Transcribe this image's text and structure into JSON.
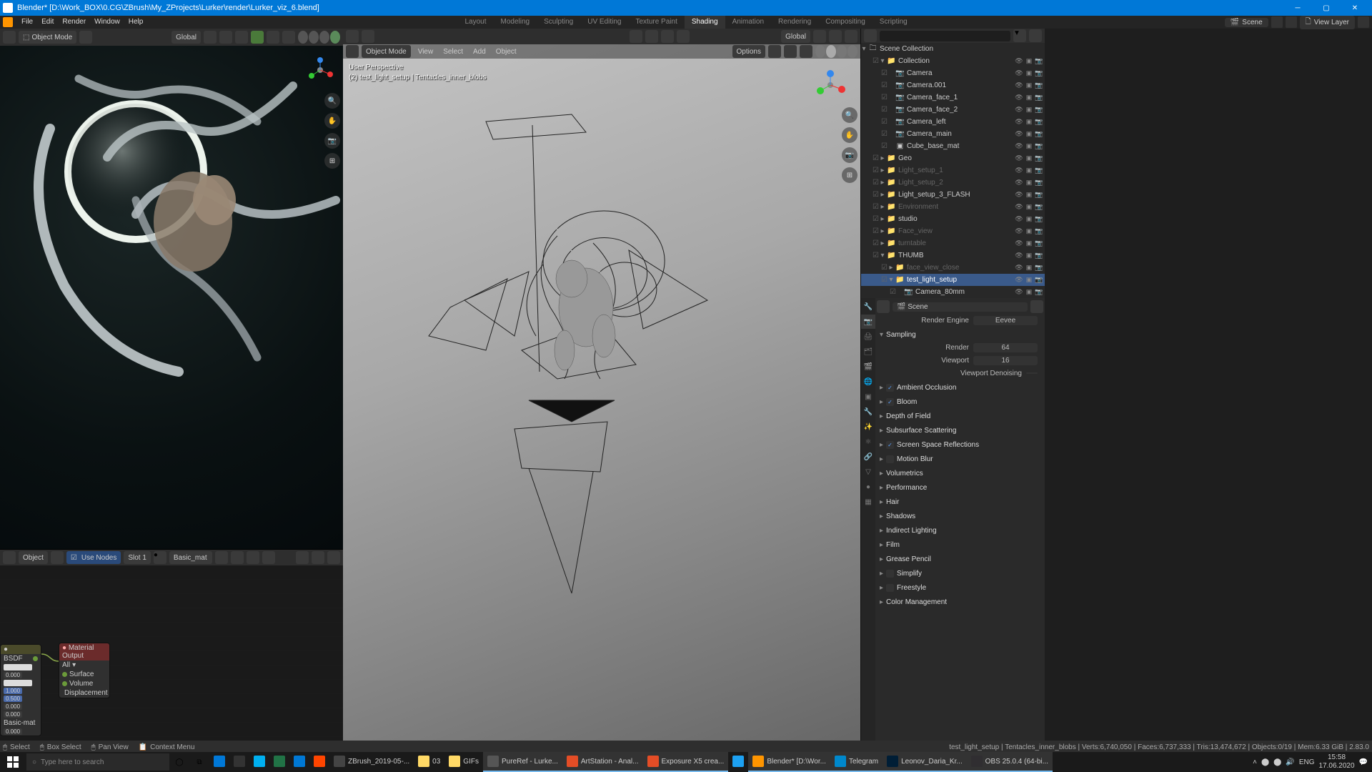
{
  "window": {
    "title": "Blender* [D:\\Work_BOX\\0.CG\\ZBrush\\My_ZProjects\\Lurker\\render\\Lurker_viz_6.blend]"
  },
  "menu": {
    "items": [
      "File",
      "Edit",
      "Render",
      "Window",
      "Help"
    ],
    "tabs": [
      "Layout",
      "Modeling",
      "Sculpting",
      "UV Editing",
      "Texture Paint",
      "Shading",
      "Animation",
      "Rendering",
      "Compositing",
      "Scripting"
    ],
    "active_tab": 5,
    "scene": "Scene",
    "view_layer": "View Layer"
  },
  "view_left": {
    "mode": "Object Mode",
    "orient": "Global"
  },
  "view_center": {
    "mode": "Object Mode",
    "menus": [
      "View",
      "Select",
      "Add",
      "Object"
    ],
    "orient": "Global",
    "options": "Options",
    "info1": "User Perspective",
    "info2": "(2) test_light_setup | Tentacles_inner_blobs"
  },
  "node": {
    "type_menu": "Object",
    "use_nodes": "Use Nodes",
    "slot": "Slot 1",
    "mat": "Basic_mat",
    "n_bsdf": "BSDF",
    "n_shader": "Basic-mat",
    "vals": [
      "0.000",
      "1.000",
      "0.500",
      "0.000",
      "0.000",
      "0.000"
    ],
    "n_out": "Material Output",
    "out_target": "All",
    "out_sockets": [
      "Surface",
      "Volume",
      "Displacement"
    ]
  },
  "outliner": {
    "root": "Scene Collection",
    "items": [
      {
        "name": "Collection",
        "i": 1,
        "tri": "▾",
        "icon": "📁",
        "dim": false
      },
      {
        "name": "Camera",
        "i": 2,
        "icon": "📷",
        "dim": false
      },
      {
        "name": "Camera.001",
        "i": 2,
        "icon": "📷",
        "dim": false
      },
      {
        "name": "Camera_face_1",
        "i": 2,
        "icon": "📷",
        "dim": false
      },
      {
        "name": "Camera_face_2",
        "i": 2,
        "icon": "📷",
        "dim": false
      },
      {
        "name": "Camera_left",
        "i": 2,
        "icon": "📷",
        "dim": false
      },
      {
        "name": "Camera_main",
        "i": 2,
        "icon": "📷",
        "dim": false
      },
      {
        "name": "Cube_base_mat",
        "i": 2,
        "icon": "▣",
        "dim": false
      },
      {
        "name": "Geo",
        "i": 1,
        "tri": "▸",
        "icon": "📁",
        "dim": false
      },
      {
        "name": "Light_setup_1",
        "i": 1,
        "tri": "▸",
        "icon": "📁",
        "dim": true
      },
      {
        "name": "Light_setup_2",
        "i": 1,
        "tri": "▸",
        "icon": "📁",
        "dim": true
      },
      {
        "name": "Light_setup_3_FLASH",
        "i": 1,
        "tri": "▸",
        "icon": "📁",
        "dim": false
      },
      {
        "name": "Environment",
        "i": 1,
        "tri": "▸",
        "icon": "📁",
        "dim": true
      },
      {
        "name": "studio",
        "i": 1,
        "tri": "▸",
        "icon": "📁",
        "dim": false
      },
      {
        "name": "Face_view",
        "i": 1,
        "tri": "▸",
        "icon": "📁",
        "dim": true
      },
      {
        "name": "turntable",
        "i": 1,
        "tri": "▸",
        "icon": "📁",
        "dim": true
      },
      {
        "name": "THUMB",
        "i": 1,
        "tri": "▾",
        "icon": "📁",
        "dim": false
      },
      {
        "name": "face_view_close",
        "i": 2,
        "tri": "▸",
        "icon": "📁",
        "dim": true
      },
      {
        "name": "test_light_setup",
        "i": 2,
        "tri": "▾",
        "icon": "📁",
        "dim": false,
        "sel": true
      },
      {
        "name": "Camera_80mm",
        "i": 3,
        "icon": "📷",
        "dim": false
      }
    ]
  },
  "props": {
    "scene_label": "Scene",
    "render_engine_lbl": "Render Engine",
    "render_engine": "Eevee",
    "sampling": "Sampling",
    "render_lbl": "Render",
    "render_val": "64",
    "viewport_lbl": "Viewport",
    "viewport_val": "16",
    "viewport_denoise": "Viewport Denoising",
    "panels": [
      {
        "name": "Ambient Occlusion",
        "chk": true
      },
      {
        "name": "Bloom",
        "chk": true
      },
      {
        "name": "Depth of Field",
        "chk": null
      },
      {
        "name": "Subsurface Scattering",
        "chk": null
      },
      {
        "name": "Screen Space Reflections",
        "chk": true
      },
      {
        "name": "Motion Blur",
        "chk": false
      },
      {
        "name": "Volumetrics",
        "chk": null
      },
      {
        "name": "Performance",
        "chk": null
      },
      {
        "name": "Hair",
        "chk": null
      },
      {
        "name": "Shadows",
        "chk": null
      },
      {
        "name": "Indirect Lighting",
        "chk": null
      },
      {
        "name": "Film",
        "chk": null
      },
      {
        "name": "Grease Pencil",
        "chk": null
      },
      {
        "name": "Simplify",
        "chk": false
      },
      {
        "name": "Freestyle",
        "chk": false
      },
      {
        "name": "Color Management",
        "chk": null
      }
    ]
  },
  "status": {
    "left": [
      {
        "icon": "🖱",
        "text": "Select"
      },
      {
        "icon": "🖱",
        "text": "Box Select"
      },
      {
        "icon": "🖱",
        "text": "Pan View"
      },
      {
        "icon": "📋",
        "text": "Context Menu"
      }
    ],
    "right": "test_light_setup | Tentacles_inner_blobs | Verts:6,740,050 | Faces:6,737,333 | Tris:13,474,672 | Objects:0/19 | Mem:6.33 GiB | 2.83.0"
  },
  "taskbar": {
    "search": "Type here to search",
    "apps": [
      {
        "label": "",
        "color": "#0078d7"
      },
      {
        "label": "",
        "color": "#333"
      },
      {
        "label": "",
        "color": "#00aff0"
      },
      {
        "label": "",
        "color": "#217346"
      },
      {
        "label": "",
        "color": "#0078d4"
      },
      {
        "label": "",
        "color": "#ff4500"
      },
      {
        "label": "ZBrush_2019-05-...",
        "color": "#444",
        "active": false
      },
      {
        "label": "03",
        "color": "#ffd966",
        "active": false
      },
      {
        "label": "GIFs",
        "color": "#ffd966",
        "active": false
      },
      {
        "label": "PureRef - Lurke...",
        "color": "#555",
        "active": true
      },
      {
        "label": "ArtStation - Anal...",
        "color": "#e44d26",
        "active": true
      },
      {
        "label": "Exposure X5 crea...",
        "color": "#e44d26",
        "active": true
      },
      {
        "label": "",
        "color": "#1da1f2",
        "active": false
      },
      {
        "label": "Blender* [D:\\Wor...",
        "color": "#ff9500",
        "active": true
      },
      {
        "label": "Telegram",
        "color": "#0088cc",
        "active": true
      },
      {
        "label": "Leonov_Daria_Kr...",
        "color": "#001e36",
        "active": true
      },
      {
        "label": "OBS 25.0.4 (64-bi...",
        "color": "#302e31",
        "active": true
      }
    ],
    "tray": [
      "🔊",
      "ENG"
    ],
    "time": "15:58",
    "date": "17.06.2020"
  }
}
